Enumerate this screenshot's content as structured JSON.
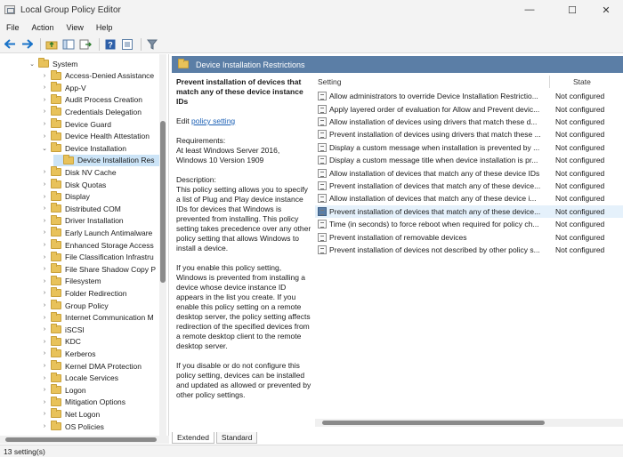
{
  "window": {
    "title": "Local Group Policy Editor",
    "minimize_glyph": "—",
    "maximize_glyph": "☐",
    "close_glyph": "✕"
  },
  "menu": [
    "File",
    "Action",
    "View",
    "Help"
  ],
  "toolbar": {
    "buttons": [
      "back-icon",
      "forward-icon",
      "up-folder-icon",
      "show-hide-tree-icon",
      "export-list-icon",
      "help-icon",
      "properties-icon",
      "filter-icon"
    ],
    "accent_color": "#1a73c8"
  },
  "tree": {
    "items": [
      {
        "label": "System",
        "indent": 2,
        "expanded": true
      },
      {
        "label": "Access-Denied Assistance",
        "indent": 3
      },
      {
        "label": "App-V",
        "indent": 3
      },
      {
        "label": "Audit Process Creation",
        "indent": 3
      },
      {
        "label": "Credentials Delegation",
        "indent": 3
      },
      {
        "label": "Device Guard",
        "indent": 3
      },
      {
        "label": "Device Health Attestation",
        "indent": 3
      },
      {
        "label": "Device Installation",
        "indent": 3,
        "expanded": true
      },
      {
        "label": "Device Installation Res",
        "indent": 4,
        "selected": true
      },
      {
        "label": "Disk NV Cache",
        "indent": 3
      },
      {
        "label": "Disk Quotas",
        "indent": 3
      },
      {
        "label": "Display",
        "indent": 3
      },
      {
        "label": "Distributed COM",
        "indent": 3
      },
      {
        "label": "Driver Installation",
        "indent": 3
      },
      {
        "label": "Early Launch Antimalware",
        "indent": 3
      },
      {
        "label": "Enhanced Storage Access",
        "indent": 3
      },
      {
        "label": "File Classification Infrastru",
        "indent": 3
      },
      {
        "label": "File Share Shadow Copy P",
        "indent": 3
      },
      {
        "label": "Filesystem",
        "indent": 3
      },
      {
        "label": "Folder Redirection",
        "indent": 3
      },
      {
        "label": "Group Policy",
        "indent": 3
      },
      {
        "label": "Internet Communication M",
        "indent": 3
      },
      {
        "label": "iSCSI",
        "indent": 3
      },
      {
        "label": "KDC",
        "indent": 3
      },
      {
        "label": "Kerberos",
        "indent": 3
      },
      {
        "label": "Kernel DMA Protection",
        "indent": 3
      },
      {
        "label": "Locale Services",
        "indent": 3
      },
      {
        "label": "Logon",
        "indent": 3
      },
      {
        "label": "Mitigation Options",
        "indent": 3
      },
      {
        "label": "Net Logon",
        "indent": 3
      },
      {
        "label": "OS Policies",
        "indent": 3
      }
    ]
  },
  "right_header": "Device Installation Restrictions",
  "description": {
    "title": "Prevent installation of devices that match any of these device instance IDs",
    "edit_prefix": "Edit ",
    "edit_link": "policy setting",
    "requirements_label": "Requirements:",
    "requirements_text": "At least Windows Server 2016, Windows 10 Version 1909",
    "description_label": "Description:",
    "p1": "This policy setting allows you to specify a list of Plug and Play device instance IDs for devices that Windows is prevented from installing. This policy setting takes precedence over any other policy setting that allows Windows to install a device.",
    "p2": "If you enable this policy setting, Windows is prevented from installing a device whose device instance ID appears in the list you create. If you enable this policy setting on a remote desktop server, the policy setting affects redirection of the specified devices from a remote desktop client to the remote desktop server.",
    "p3": "If you disable or do not configure this policy setting, devices can be installed and updated as allowed or prevented by other policy settings."
  },
  "settings": {
    "col_setting": "Setting",
    "col_state": "State",
    "rows": [
      {
        "name": "Allow administrators to override Device Installation Restrictio...",
        "state": "Not configured"
      },
      {
        "name": "Apply layered order of evaluation for Allow and Prevent devic...",
        "state": "Not configured"
      },
      {
        "name": "Allow installation of devices using drivers that match these d...",
        "state": "Not configured"
      },
      {
        "name": "Prevent installation of devices using drivers that match these ...",
        "state": "Not configured"
      },
      {
        "name": "Display a custom message when installation is prevented by ...",
        "state": "Not configured"
      },
      {
        "name": "Display a custom message title when device installation is pr...",
        "state": "Not configured"
      },
      {
        "name": "Allow installation of devices that match any of these device IDs",
        "state": "Not configured"
      },
      {
        "name": "Prevent installation of devices that match any of these device...",
        "state": "Not configured"
      },
      {
        "name": "Allow installation of devices that match any of these device i...",
        "state": "Not configured"
      },
      {
        "name": "Prevent installation of devices that match any of these device...",
        "state": "Not configured",
        "selected": true
      },
      {
        "name": "Time (in seconds) to force reboot when required for policy ch...",
        "state": "Not configured"
      },
      {
        "name": "Prevent installation of removable devices",
        "state": "Not configured"
      },
      {
        "name": "Prevent installation of devices not described by other policy s...",
        "state": "Not configured"
      }
    ]
  },
  "tabs": [
    "Extended",
    "Standard"
  ],
  "status": "13 setting(s)"
}
